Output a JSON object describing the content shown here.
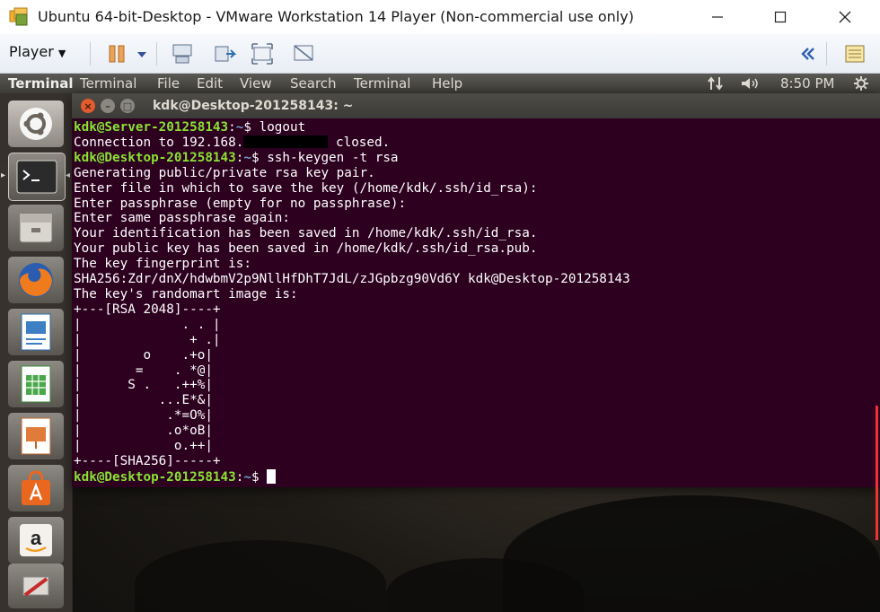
{
  "window": {
    "title": "Ubuntu 64-bit-Desktop - VMware Workstation 14 Player (Non-commercial use only)",
    "minimize_icon": "minimize-icon",
    "maximize_icon": "maximize-icon",
    "close_icon": "close-icon"
  },
  "vm_toolbar": {
    "player_menu_label": "Player",
    "icons": [
      "pause-icon",
      "dropdown-icon",
      "send-ctrl-alt-del-icon",
      "removable-devices-icon",
      "fullscreen-icon",
      "unity-icon",
      "collapse-icon",
      "library-icon"
    ]
  },
  "top_panel": {
    "app_name": "Terminal",
    "menus": [
      "Terminal",
      "File",
      "Edit",
      "View",
      "Search",
      "Terminal",
      "Help"
    ],
    "time": "8:50 PM"
  },
  "launcher": {
    "items": [
      "ubuntu-dash",
      "terminal",
      "files",
      "firefox",
      "libreoffice-writer",
      "libreoffice-calc",
      "libreoffice-impress",
      "ubuntu-software",
      "amazon",
      "system-settings"
    ]
  },
  "terminal": {
    "title": "kdk@Desktop-201258143: ~",
    "lines": [
      {
        "kind": "prompt",
        "user": "kdk@Server-201258143",
        "path": "~",
        "cmd": " logout"
      },
      {
        "kind": "redacted",
        "before": "Connection to 192.168.",
        "after": " closed."
      },
      {
        "kind": "prompt",
        "user": "kdk@Desktop-201258143",
        "path": "~",
        "cmd": " ssh-keygen -t rsa"
      },
      {
        "kind": "text",
        "text": "Generating public/private rsa key pair."
      },
      {
        "kind": "text",
        "text": "Enter file in which to save the key (/home/kdk/.ssh/id_rsa):"
      },
      {
        "kind": "text",
        "text": "Enter passphrase (empty for no passphrase):"
      },
      {
        "kind": "text",
        "text": "Enter same passphrase again:"
      },
      {
        "kind": "text",
        "text": "Your identification has been saved in /home/kdk/.ssh/id_rsa."
      },
      {
        "kind": "text",
        "text": "Your public key has been saved in /home/kdk/.ssh/id_rsa.pub."
      },
      {
        "kind": "text",
        "text": "The key fingerprint is:"
      },
      {
        "kind": "text",
        "text": "SHA256:Zdr/dnX/hdwbmV2p9NllHfDhT7JdL/zJGpbzg90Vd6Y kdk@Desktop-201258143"
      },
      {
        "kind": "text",
        "text": "The key's randomart image is:"
      },
      {
        "kind": "text",
        "text": "+---[RSA 2048]----+"
      },
      {
        "kind": "text",
        "text": "|             . . |"
      },
      {
        "kind": "text",
        "text": "|              + .|"
      },
      {
        "kind": "text",
        "text": "|        o    .+o|"
      },
      {
        "kind": "text",
        "text": "|       =    . *@|"
      },
      {
        "kind": "text",
        "text": "|      S .   .++%|"
      },
      {
        "kind": "text",
        "text": "|          ...E*&|"
      },
      {
        "kind": "text",
        "text": "|           .*=O%|"
      },
      {
        "kind": "text",
        "text": "|           .o*oB|"
      },
      {
        "kind": "text",
        "text": "|            o.++|"
      },
      {
        "kind": "text",
        "text": "+----[SHA256]-----+"
      },
      {
        "kind": "prompt_cursor",
        "user": "kdk@Desktop-201258143",
        "path": "~",
        "cmd": " "
      }
    ]
  },
  "colors": {
    "terminal_bg": "#2c001e",
    "prompt_green": "#8ae234",
    "path_blue": "#729fcf",
    "vm_toolbar_accent": "#e8a35a"
  }
}
